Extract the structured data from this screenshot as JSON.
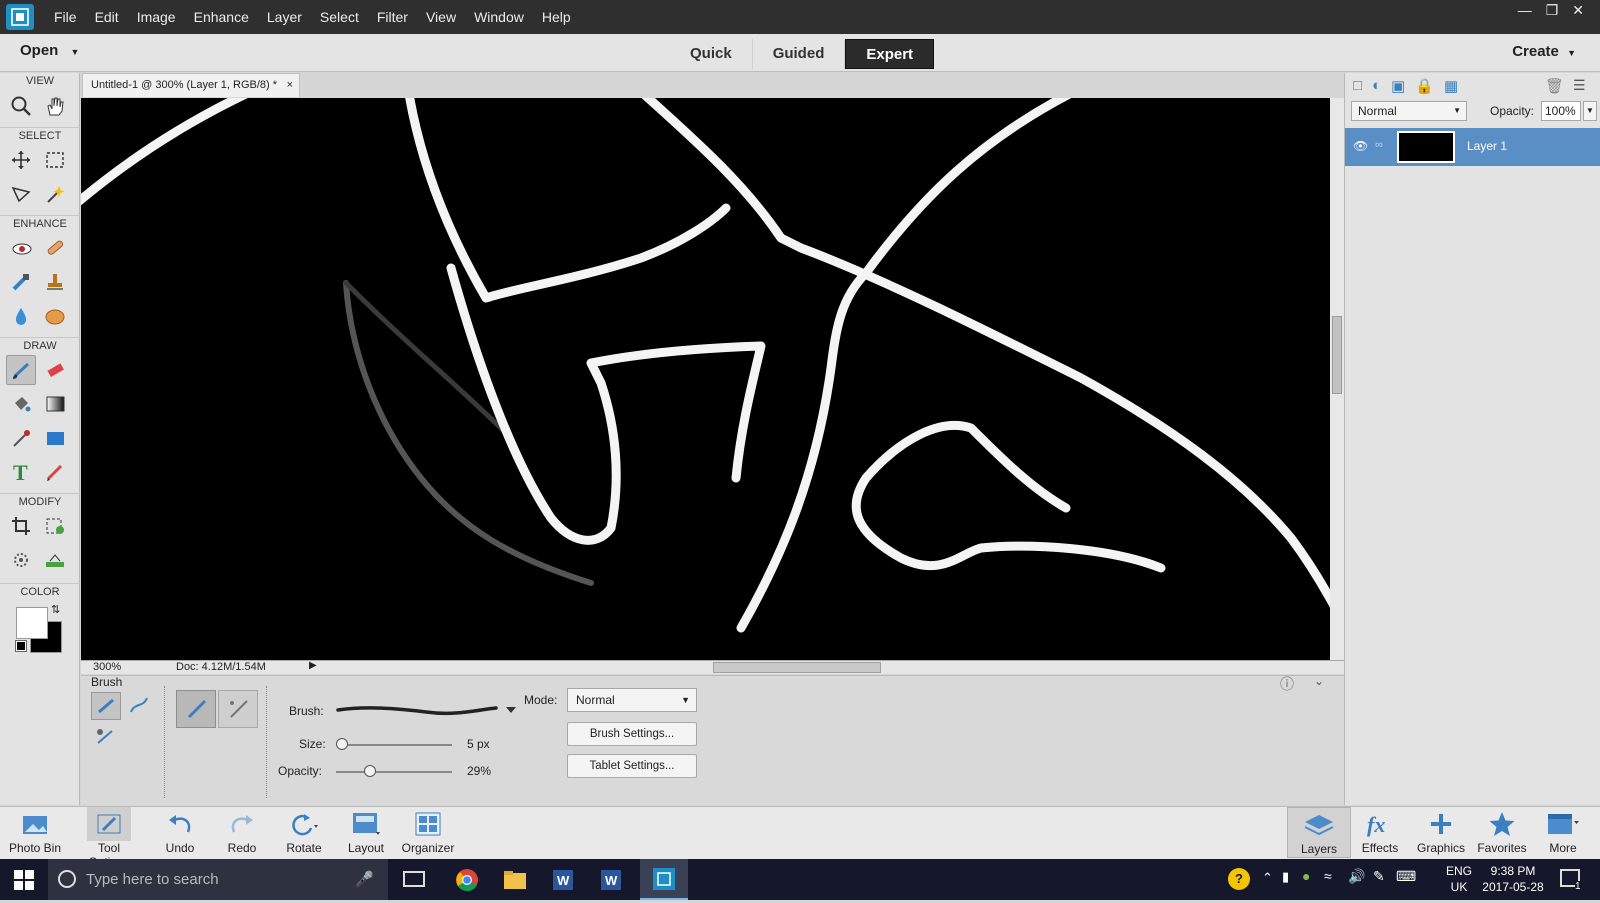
{
  "menubar": {
    "items": [
      "File",
      "Edit",
      "Image",
      "Enhance",
      "Layer",
      "Select",
      "Filter",
      "View",
      "Window",
      "Help"
    ]
  },
  "modebar": {
    "open_label": "Open",
    "modes": [
      "Quick",
      "Guided",
      "Expert"
    ],
    "active_mode": "Expert",
    "create_label": "Create"
  },
  "toolbox": {
    "sections": [
      "VIEW",
      "SELECT",
      "ENHANCE",
      "DRAW",
      "MODIFY",
      "COLOR"
    ]
  },
  "document": {
    "tab_title": "Untitled-1 @ 300% (Layer 1, RGB/8) *",
    "zoom": "300%",
    "doc_size": "Doc: 4.12M/1.54M"
  },
  "tool_options": {
    "tool_name": "Brush",
    "brush_label": "Brush:",
    "size_label": "Size:",
    "size_value": "5 px",
    "size_fraction": 0.0,
    "opacity_label": "Opacity:",
    "opacity_value": "29%",
    "opacity_fraction": 0.29,
    "mode_label": "Mode:",
    "mode_value": "Normal",
    "brush_settings_label": "Brush Settings...",
    "tablet_settings_label": "Tablet Settings..."
  },
  "layers_panel": {
    "blend_mode": "Normal",
    "opacity_label": "Opacity:",
    "opacity_value": "100%",
    "layer_name": "Layer 1"
  },
  "bottom_bar": {
    "left": [
      "Photo Bin",
      "Tool Options",
      "Undo",
      "Redo",
      "Rotate",
      "Layout",
      "Organizer"
    ],
    "right": [
      "Layers",
      "Effects",
      "Graphics",
      "Favorites",
      "More"
    ]
  },
  "taskbar": {
    "search_placeholder": "Type here to search",
    "language": "ENG",
    "region": "UK",
    "time": "9:38 PM",
    "date": "2017-05-28",
    "notification_count": "1"
  },
  "colors": {
    "accent": "#1e8fc4",
    "layer_selected": "#5a8fc6",
    "active_mode_bg": "#2b2b2b",
    "taskbar_bg": "#14182a"
  }
}
